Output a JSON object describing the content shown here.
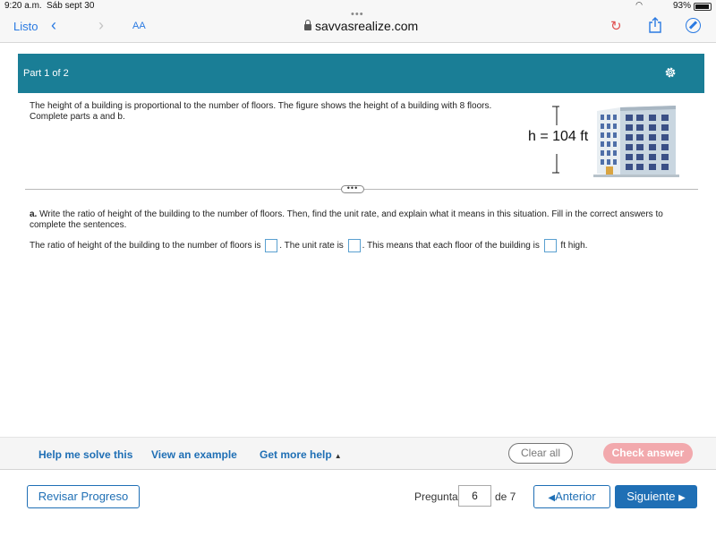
{
  "status_bar": {
    "time": "9:20 a.m.",
    "date": "Sáb sept 30",
    "battery": "93%"
  },
  "browser": {
    "done_label": "Listo",
    "text_size_label": "AA",
    "url": "savvasrealize.com",
    "icons": [
      "chevron-left-icon",
      "chevron-right-icon",
      "lock-icon",
      "reload-icon",
      "share-icon",
      "compass-icon"
    ]
  },
  "part_header": {
    "label": "Part 1 of 2",
    "background": "#1a7e96",
    "icon": "gear-icon"
  },
  "problem": {
    "text": "The height of a building is proportional to the number of floors. The figure shows the height of a building with 8 floors. Complete parts a and b."
  },
  "figure": {
    "height_label": "h = 104 ft"
  },
  "part_a": {
    "prefix": "a.",
    "instruction": "Write the ratio of height of the building to the number of floors. Then, find the unit rate, and explain what it means in this situation. Fill in the correct answers to complete the sentences.",
    "sentence_1": "The ratio of height of the building to the number of floors is",
    "sentence_2": ". The unit rate is",
    "sentence_3": ". This means that each floor of the building is",
    "sentence_4": "ft high."
  },
  "help_bar": {
    "help_solve": "Help me solve this",
    "view_example": "View an example",
    "more_help": "Get more help",
    "clear_all": "Clear all",
    "check_answer": "Check answer"
  },
  "footer": {
    "review_progress": "Revisar Progreso",
    "question_label": "Pregunta",
    "question_number": "6",
    "question_total": "de 7",
    "previous": "Anterior",
    "next": "Siguiente",
    "accent": "#1f6fb5"
  }
}
